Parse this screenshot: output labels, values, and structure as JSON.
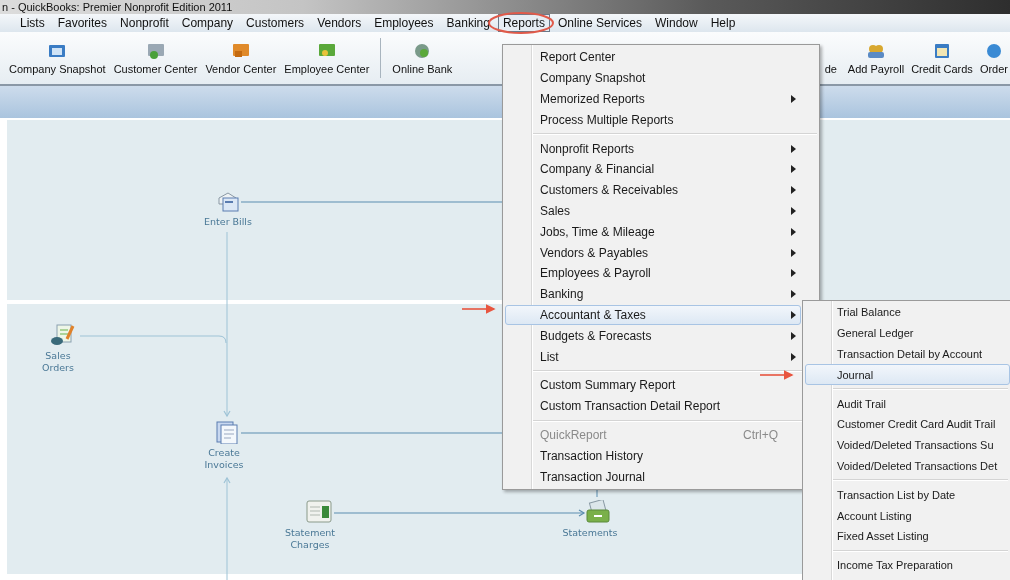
{
  "window": {
    "title": "n  - QuickBooks: Premier Nonprofit Edition 2011"
  },
  "menu_bar": [
    {
      "label": "Lists",
      "selected": false
    },
    {
      "label": "Favorites",
      "selected": false
    },
    {
      "label": "Nonprofit",
      "selected": false
    },
    {
      "label": "Company",
      "selected": false
    },
    {
      "label": "Customers",
      "selected": false
    },
    {
      "label": "Vendors",
      "selected": false
    },
    {
      "label": "Employees",
      "selected": false
    },
    {
      "label": "Banking",
      "selected": false
    },
    {
      "label": "Reports",
      "selected": true
    },
    {
      "label": "Online Services",
      "selected": false
    },
    {
      "label": "Window",
      "selected": false
    },
    {
      "label": "Help",
      "selected": false
    }
  ],
  "toolbar": {
    "left": [
      {
        "label": "Company Snapshot"
      },
      {
        "label": "Customer Center"
      },
      {
        "label": "Vendor Center"
      },
      {
        "label": "Employee Center"
      },
      {
        "label": "Online Bank"
      }
    ],
    "right": [
      {
        "label": "de"
      },
      {
        "label": "Add Payroll"
      },
      {
        "label": "Credit Cards"
      },
      {
        "label": "Order"
      }
    ]
  },
  "diagram": {
    "nodes": [
      {
        "label": "Enter Bills"
      },
      {
        "label": "Sales\nOrders"
      },
      {
        "label": "Create\nInvoices"
      },
      {
        "label": "Statement\nCharges"
      },
      {
        "label": "Statements"
      }
    ]
  },
  "reports_menu": {
    "items": [
      {
        "kind": "item",
        "label": "Report Center",
        "has_submenu": false,
        "selected": false,
        "disabled": false
      },
      {
        "kind": "item",
        "label": "Company Snapshot",
        "has_submenu": false,
        "selected": false,
        "disabled": false
      },
      {
        "kind": "item",
        "label": "Memorized Reports",
        "has_submenu": true,
        "selected": false,
        "disabled": false
      },
      {
        "kind": "item",
        "label": "Process Multiple Reports",
        "has_submenu": false,
        "selected": false,
        "disabled": false
      },
      {
        "kind": "separator"
      },
      {
        "kind": "item",
        "label": "Nonprofit Reports",
        "has_submenu": true,
        "selected": false,
        "disabled": false
      },
      {
        "kind": "item",
        "label": "Company & Financial",
        "has_submenu": true,
        "selected": false,
        "disabled": false
      },
      {
        "kind": "item",
        "label": "Customers & Receivables",
        "has_submenu": true,
        "selected": false,
        "disabled": false
      },
      {
        "kind": "item",
        "label": "Sales",
        "has_submenu": true,
        "selected": false,
        "disabled": false
      },
      {
        "kind": "item",
        "label": "Jobs, Time & Mileage",
        "has_submenu": true,
        "selected": false,
        "disabled": false
      },
      {
        "kind": "item",
        "label": "Vendors & Payables",
        "has_submenu": true,
        "selected": false,
        "disabled": false
      },
      {
        "kind": "item",
        "label": "Employees & Payroll",
        "has_submenu": true,
        "selected": false,
        "disabled": false
      },
      {
        "kind": "item",
        "label": "Banking",
        "has_submenu": true,
        "selected": false,
        "disabled": false
      },
      {
        "kind": "item",
        "label": "Accountant & Taxes",
        "has_submenu": true,
        "selected": true,
        "disabled": false
      },
      {
        "kind": "item",
        "label": "Budgets & Forecasts",
        "has_submenu": true,
        "selected": false,
        "disabled": false
      },
      {
        "kind": "item",
        "label": "List",
        "has_submenu": true,
        "selected": false,
        "disabled": false
      },
      {
        "kind": "separator"
      },
      {
        "kind": "item",
        "label": "Custom Summary Report",
        "has_submenu": false,
        "selected": false,
        "disabled": false
      },
      {
        "kind": "item",
        "label": "Custom Transaction Detail Report",
        "has_submenu": false,
        "selected": false,
        "disabled": false
      },
      {
        "kind": "separator"
      },
      {
        "kind": "item",
        "label": "QuickReport",
        "shortcut": "Ctrl+Q",
        "has_submenu": false,
        "selected": false,
        "disabled": true
      },
      {
        "kind": "item",
        "label": "Transaction History",
        "has_submenu": false,
        "selected": false,
        "disabled": false
      },
      {
        "kind": "item",
        "label": "Transaction Journal",
        "has_submenu": false,
        "selected": false,
        "disabled": false
      }
    ]
  },
  "accountant_submenu": {
    "items": [
      {
        "kind": "item",
        "label": "Trial Balance",
        "selected": false
      },
      {
        "kind": "item",
        "label": "General Ledger",
        "selected": false
      },
      {
        "kind": "item",
        "label": "Transaction Detail by Account",
        "selected": false
      },
      {
        "kind": "item",
        "label": "Journal",
        "selected": true
      },
      {
        "kind": "separator"
      },
      {
        "kind": "item",
        "label": "Audit Trail",
        "selected": false
      },
      {
        "kind": "item",
        "label": "Customer Credit Card Audit Trail",
        "selected": false
      },
      {
        "kind": "item",
        "label": "Voided/Deleted Transactions Su",
        "selected": false
      },
      {
        "kind": "item",
        "label": "Voided/Deleted Transactions Det",
        "selected": false
      },
      {
        "kind": "separator"
      },
      {
        "kind": "item",
        "label": "Transaction List by Date",
        "selected": false
      },
      {
        "kind": "item",
        "label": "Account Listing",
        "selected": false
      },
      {
        "kind": "item",
        "label": "Fixed Asset Listing",
        "selected": false
      },
      {
        "kind": "separator"
      },
      {
        "kind": "item",
        "label": "Income Tax Preparation",
        "selected": false
      }
    ]
  }
}
